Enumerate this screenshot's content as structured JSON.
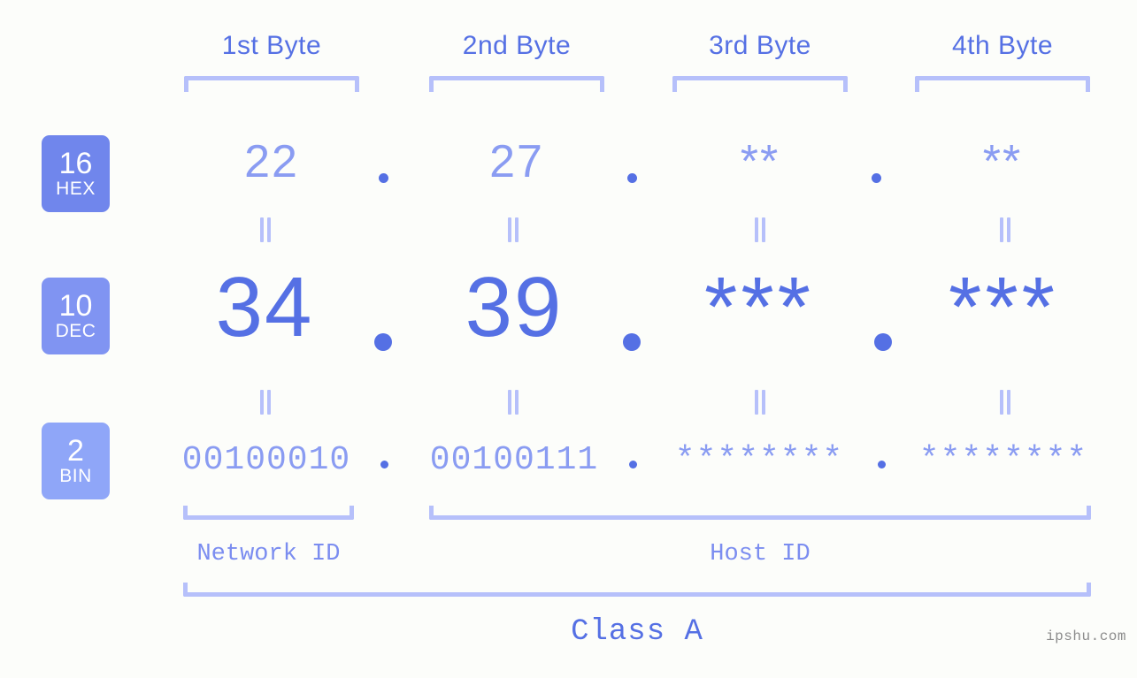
{
  "background_color": "#fcfdfa",
  "colors": {
    "primary": "#5570e4",
    "secondary": "#8a9cf2",
    "bracket": "#b6c0fa",
    "badge_hex": "#7086ec",
    "badge_dec": "#8094f2",
    "badge_bin": "#8fa6f8",
    "watermark": "#8c8c8c"
  },
  "headers": [
    {
      "label": "1st Byte"
    },
    {
      "label": "2nd Byte"
    },
    {
      "label": "3rd Byte"
    },
    {
      "label": "4th Byte"
    }
  ],
  "bases": [
    {
      "number": "16",
      "name": "HEX"
    },
    {
      "number": "10",
      "name": "DEC"
    },
    {
      "number": "2",
      "name": "BIN"
    }
  ],
  "rows": {
    "hex": {
      "base": "16",
      "name": "HEX",
      "values": [
        "22",
        "27",
        "**",
        "**"
      ],
      "separator": "."
    },
    "dec": {
      "base": "10",
      "name": "DEC",
      "values": [
        "34",
        "39",
        "***",
        "***"
      ],
      "separator": "."
    },
    "bin": {
      "base": "2",
      "name": "BIN",
      "values": [
        "00100010",
        "00100111",
        "********",
        "********"
      ],
      "separator": "."
    }
  },
  "equality_marks": [
    "=",
    "=",
    "=",
    "=",
    "=",
    "=",
    "=",
    "="
  ],
  "segments": {
    "network_id": "Network ID",
    "host_id": "Host ID"
  },
  "class_label": "Class A",
  "watermark": "ipshu.com"
}
